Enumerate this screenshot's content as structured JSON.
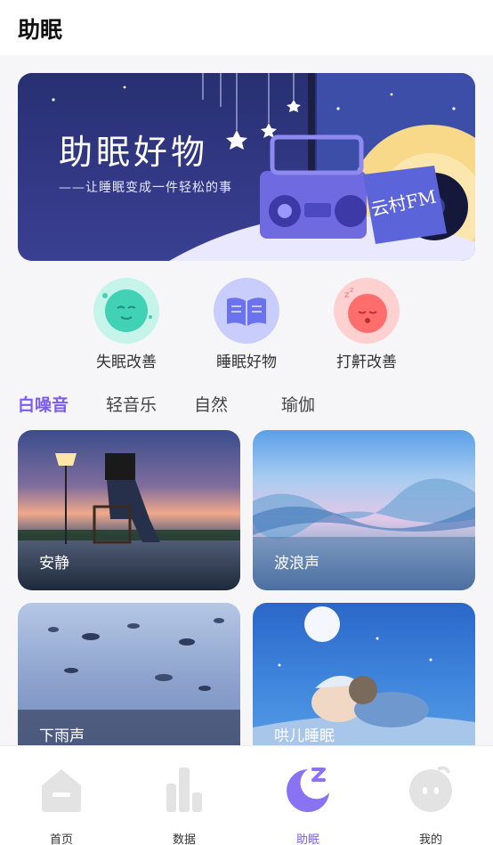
{
  "header": {
    "title": "助眠"
  },
  "banner": {
    "title": "助眠好物",
    "subtitle": "——让睡眠变成一件轻松的事",
    "fm": "云村FM"
  },
  "quick": [
    {
      "label": "失眠改善",
      "icon": "sleepy-face-icon"
    },
    {
      "label": "睡眠好物",
      "icon": "book-icon"
    },
    {
      "label": "打鼾改善",
      "icon": "snoring-face-icon"
    }
  ],
  "tabs": [
    "白噪音",
    "轻音乐",
    "自然",
    "瑜伽"
  ],
  "active_tab": "白噪音",
  "cards": [
    "安静",
    "波浪声",
    "下雨声",
    "哄儿睡眠"
  ],
  "tabbar": [
    "首页",
    "数据",
    "助眠",
    "我的"
  ],
  "active_tabbar": "助眠",
  "colors": {
    "accent": "#7a5cf0"
  }
}
